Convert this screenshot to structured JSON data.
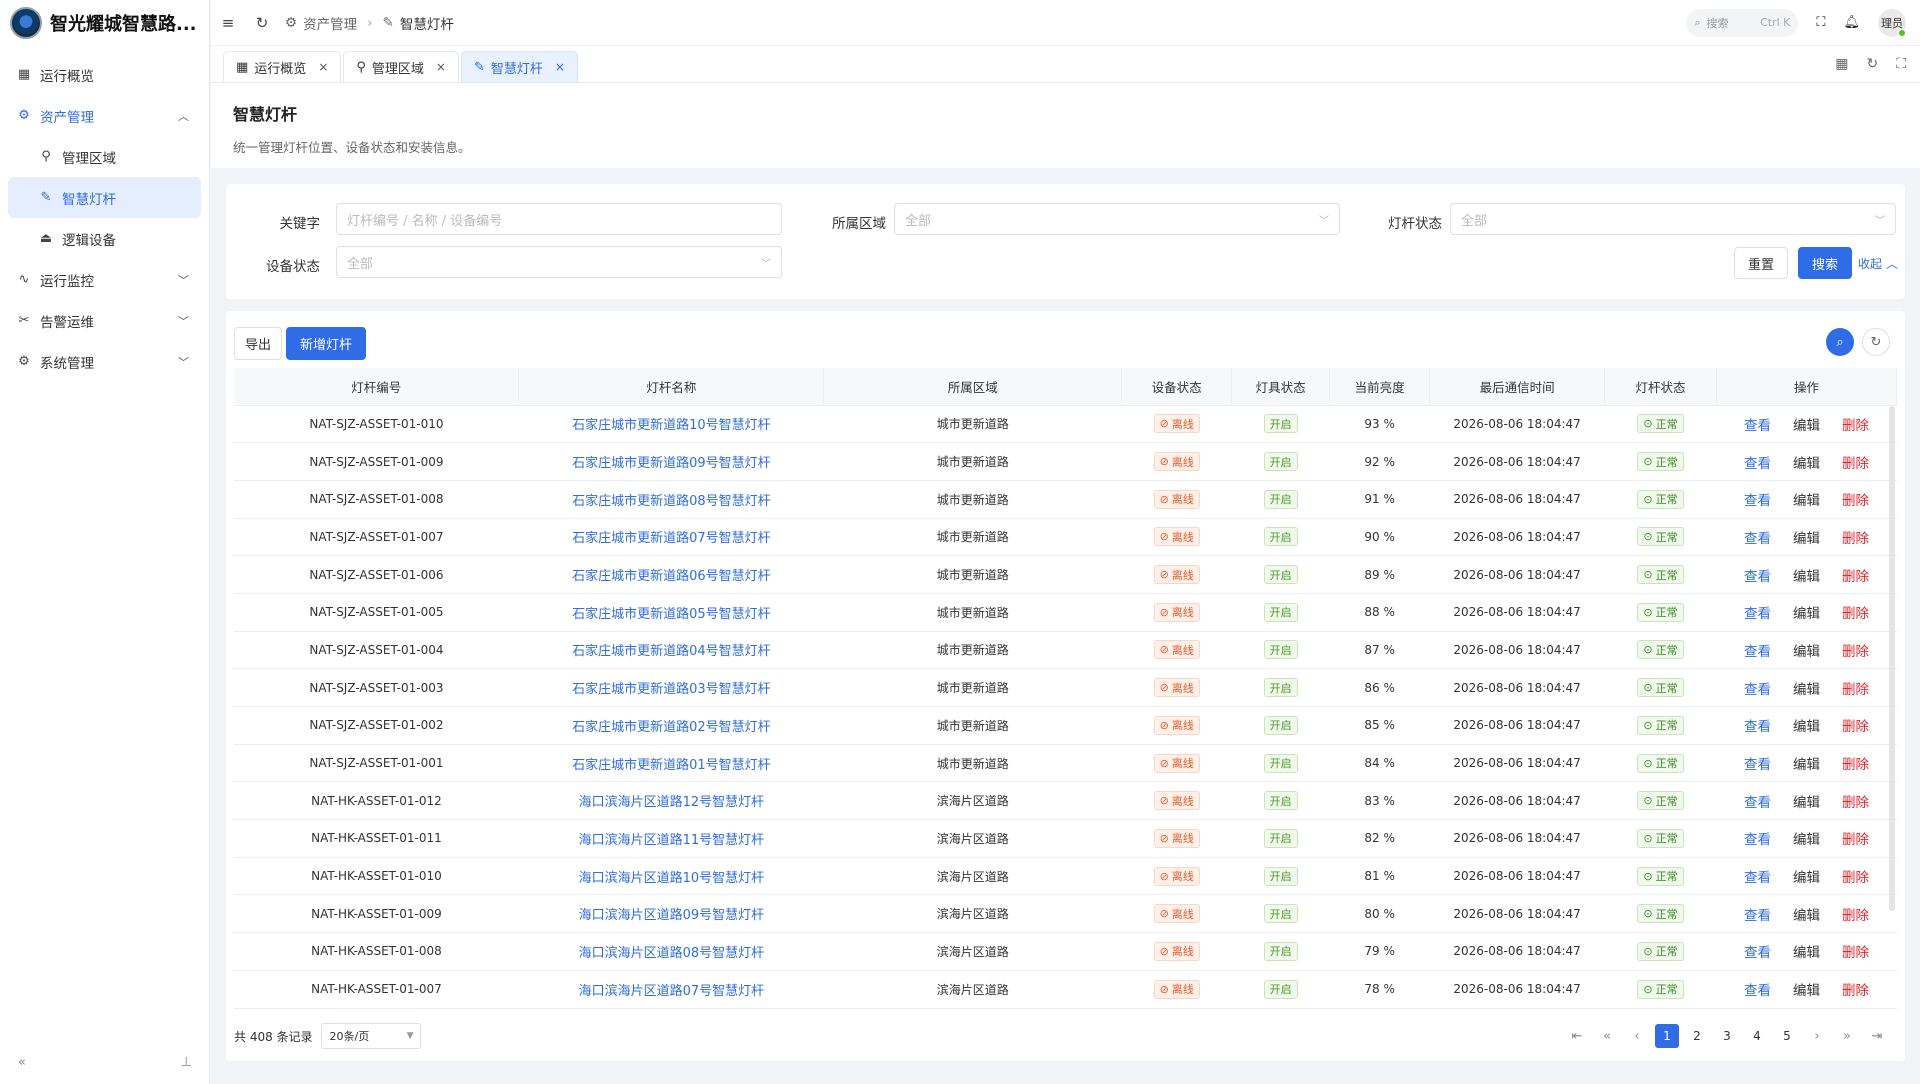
{
  "app": {
    "title": "智光耀城智慧路..."
  },
  "sidebar": {
    "items": [
      {
        "label": "运行概览"
      },
      {
        "label": "资产管理"
      },
      {
        "label": "管理区域"
      },
      {
        "label": "智慧灯杆"
      },
      {
        "label": "逻辑设备"
      },
      {
        "label": "运行监控"
      },
      {
        "label": "告警运维"
      },
      {
        "label": "系统管理"
      }
    ]
  },
  "topbar": {
    "breadcrumb": [
      "资产管理",
      "智慧灯杆"
    ],
    "search_placeholder": "搜索",
    "search_shortcut": "Ctrl K",
    "user": "理员"
  },
  "tabs": [
    {
      "label": "运行概览"
    },
    {
      "label": "管理区域"
    },
    {
      "label": "智慧灯杆"
    }
  ],
  "page": {
    "title": "智慧灯杆",
    "desc": "统一管理灯杆位置、设备状态和安装信息。"
  },
  "filter": {
    "keyword_label": "关键字",
    "keyword_placeholder": "灯杆编号 / 名称 / 设备编号",
    "area_label": "所属区域",
    "area_value": "全部",
    "pole_status_label": "灯杆状态",
    "pole_status_value": "全部",
    "device_status_label": "设备状态",
    "device_status_value": "全部",
    "reset": "重置",
    "search": "搜索",
    "collapse": "收起"
  },
  "toolbar": {
    "export": "导出",
    "add": "新增灯杆"
  },
  "table": {
    "headers": [
      "灯杆编号",
      "灯杆名称",
      "所属区域",
      "设备状态",
      "灯具状态",
      "当前亮度",
      "最后通信时间",
      "灯杆状态",
      "操作"
    ],
    "ops": {
      "view": "查看",
      "edit": "编辑",
      "delete": "删除"
    },
    "rows": [
      {
        "id": "NAT-SJZ-ASSET-01-010",
        "name": "石家庄城市更新道路10号智慧灯杆",
        "area": "城市更新道路",
        "device": "离线",
        "lamp": "开启",
        "brightness": "93 %",
        "time": "2026-08-06 18:04:47",
        "status": "正常"
      },
      {
        "id": "NAT-SJZ-ASSET-01-009",
        "name": "石家庄城市更新道路09号智慧灯杆",
        "area": "城市更新道路",
        "device": "离线",
        "lamp": "开启",
        "brightness": "92 %",
        "time": "2026-08-06 18:04:47",
        "status": "正常"
      },
      {
        "id": "NAT-SJZ-ASSET-01-008",
        "name": "石家庄城市更新道路08号智慧灯杆",
        "area": "城市更新道路",
        "device": "离线",
        "lamp": "开启",
        "brightness": "91 %",
        "time": "2026-08-06 18:04:47",
        "status": "正常"
      },
      {
        "id": "NAT-SJZ-ASSET-01-007",
        "name": "石家庄城市更新道路07号智慧灯杆",
        "area": "城市更新道路",
        "device": "离线",
        "lamp": "开启",
        "brightness": "90 %",
        "time": "2026-08-06 18:04:47",
        "status": "正常"
      },
      {
        "id": "NAT-SJZ-ASSET-01-006",
        "name": "石家庄城市更新道路06号智慧灯杆",
        "area": "城市更新道路",
        "device": "离线",
        "lamp": "开启",
        "brightness": "89 %",
        "time": "2026-08-06 18:04:47",
        "status": "正常"
      },
      {
        "id": "NAT-SJZ-ASSET-01-005",
        "name": "石家庄城市更新道路05号智慧灯杆",
        "area": "城市更新道路",
        "device": "离线",
        "lamp": "开启",
        "brightness": "88 %",
        "time": "2026-08-06 18:04:47",
        "status": "正常"
      },
      {
        "id": "NAT-SJZ-ASSET-01-004",
        "name": "石家庄城市更新道路04号智慧灯杆",
        "area": "城市更新道路",
        "device": "离线",
        "lamp": "开启",
        "brightness": "87 %",
        "time": "2026-08-06 18:04:47",
        "status": "正常"
      },
      {
        "id": "NAT-SJZ-ASSET-01-003",
        "name": "石家庄城市更新道路03号智慧灯杆",
        "area": "城市更新道路",
        "device": "离线",
        "lamp": "开启",
        "brightness": "86 %",
        "time": "2026-08-06 18:04:47",
        "status": "正常"
      },
      {
        "id": "NAT-SJZ-ASSET-01-002",
        "name": "石家庄城市更新道路02号智慧灯杆",
        "area": "城市更新道路",
        "device": "离线",
        "lamp": "开启",
        "brightness": "85 %",
        "time": "2026-08-06 18:04:47",
        "status": "正常"
      },
      {
        "id": "NAT-SJZ-ASSET-01-001",
        "name": "石家庄城市更新道路01号智慧灯杆",
        "area": "城市更新道路",
        "device": "离线",
        "lamp": "开启",
        "brightness": "84 %",
        "time": "2026-08-06 18:04:47",
        "status": "正常"
      },
      {
        "id": "NAT-HK-ASSET-01-012",
        "name": "海口滨海片区道路12号智慧灯杆",
        "area": "滨海片区道路",
        "device": "离线",
        "lamp": "开启",
        "brightness": "83 %",
        "time": "2026-08-06 18:04:47",
        "status": "正常"
      },
      {
        "id": "NAT-HK-ASSET-01-011",
        "name": "海口滨海片区道路11号智慧灯杆",
        "area": "滨海片区道路",
        "device": "离线",
        "lamp": "开启",
        "brightness": "82 %",
        "time": "2026-08-06 18:04:47",
        "status": "正常"
      },
      {
        "id": "NAT-HK-ASSET-01-010",
        "name": "海口滨海片区道路10号智慧灯杆",
        "area": "滨海片区道路",
        "device": "离线",
        "lamp": "开启",
        "brightness": "81 %",
        "time": "2026-08-06 18:04:47",
        "status": "正常"
      },
      {
        "id": "NAT-HK-ASSET-01-009",
        "name": "海口滨海片区道路09号智慧灯杆",
        "area": "滨海片区道路",
        "device": "离线",
        "lamp": "开启",
        "brightness": "80 %",
        "time": "2026-08-06 18:04:47",
        "status": "正常"
      },
      {
        "id": "NAT-HK-ASSET-01-008",
        "name": "海口滨海片区道路08号智慧灯杆",
        "area": "滨海片区道路",
        "device": "离线",
        "lamp": "开启",
        "brightness": "79 %",
        "time": "2026-08-06 18:04:47",
        "status": "正常"
      },
      {
        "id": "NAT-HK-ASSET-01-007",
        "name": "海口滨海片区道路07号智慧灯杆",
        "area": "滨海片区道路",
        "device": "离线",
        "lamp": "开启",
        "brightness": "78 %",
        "time": "2026-08-06 18:04:47",
        "status": "正常"
      }
    ]
  },
  "footer": {
    "total": "共 408 条记录",
    "page_size": "20条/页",
    "pages": [
      "1",
      "2",
      "3",
      "4",
      "5"
    ],
    "current_page": "1"
  },
  "colors": {
    "accent": "#2f6ce5",
    "danger": "#e5262b",
    "offline": "#e35d2b",
    "ok": "#4e9a2b"
  }
}
